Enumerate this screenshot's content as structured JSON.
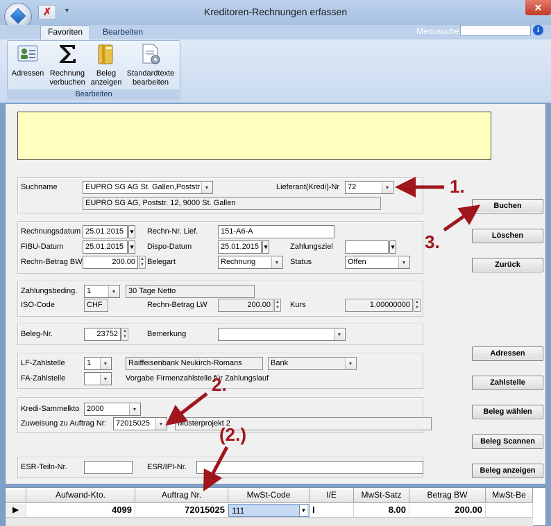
{
  "window": {
    "title": "Kreditoren-Rechnungen erfassen",
    "close_glyph": "✕",
    "qat_close_glyph": "✗",
    "qat_more_glyph": "▼",
    "info_glyph": "i"
  },
  "ribbon": {
    "tabs": [
      {
        "label": "Favoriten",
        "active": true
      },
      {
        "label": "Bearbeiten",
        "active": false
      }
    ],
    "menusuche_label": "Menusuche",
    "menusuche_value": "",
    "group_label": "Bearbeiten",
    "buttons": [
      {
        "label_line1": "Adressen",
        "label_line2": "",
        "icon": "address-book-icon"
      },
      {
        "label_line1": "Rechnung",
        "label_line2": "verbuchen",
        "icon": "sigma-icon"
      },
      {
        "label_line1": "Beleg",
        "label_line2": "anzeigen",
        "icon": "binder-icon"
      },
      {
        "label_line1": "Standardtexte",
        "label_line2": "bearbeiten",
        "icon": "document-gear-icon"
      }
    ]
  },
  "form": {
    "suchname_label": "Suchname",
    "suchname_value": "EUPRO SG AG St. Gallen,Poststr",
    "lieferant_label": "Lieferant(Kredi)-Nr",
    "lieferant_value": "72",
    "address_value": "EUPRO SG AG, Poststr. 12, 9000 St. Gallen",
    "rechnungsdatum_label": "Rechnungsdatum",
    "rechnungsdatum_value": "25.01.2015",
    "rechn_nr_lief_label": "Rechn-Nr. Lief.",
    "rechn_nr_lief_value": "151-A6-A",
    "fibu_datum_label": "FIBU-Datum",
    "fibu_datum_value": "25.01.2015",
    "dispo_datum_label": "Dispo-Datum",
    "dispo_datum_value": "25.01.2015",
    "zahlungsziel_label": "Zahlungsziel",
    "zahlungsziel_value": "",
    "rechn_betrag_bw_label": "Rechn-Betrag BW",
    "rechn_betrag_bw_value": "200.00",
    "belegart_label": "Belegart",
    "belegart_value": "Rechnung",
    "status_label": "Status",
    "status_value": "Offen",
    "zahlungsbeding_label": "Zahlungsbeding.",
    "zahlungsbeding_value": "1",
    "zahlungsbeding_text": "30 Tage Netto",
    "iso_code_label": "ISO-Code",
    "iso_code_value": "CHF",
    "rechn_betrag_lw_label": "Rechn-Betrag LW",
    "rechn_betrag_lw_value": "200.00",
    "kurs_label": "Kurs",
    "kurs_value": "1.00000000",
    "beleg_nr_label": "Beleg-Nr.",
    "beleg_nr_value": "23752",
    "bemerkung_label": "Bemerkung",
    "bemerkung_value": "",
    "lf_zahlstelle_label": "LF-Zahlstelle",
    "lf_zahlstelle_value": "1",
    "lf_zahlstelle_text": "Raiffeisenbank Neukirch-Romans",
    "lf_zahlstelle_type": "Bank",
    "fa_zahlstelle_label": "FA-Zahlstelle",
    "fa_zahlstelle_value": "",
    "fa_zahlstelle_text": "Vorgabe Firmenzahlstelle für Zahlungslauf",
    "kredi_sammelkto_label": "Kredi-Sammelkto",
    "kredi_sammelkto_value": "2000",
    "zuweisung_label": "Zuweisung zu Auftrag Nr:",
    "zuweisung_value": "72015025",
    "zuweisung_text": "Musterprojekt 2",
    "esr_teiln_label": "ESR-Teiln-Nr.",
    "esr_teiln_value": "",
    "esr_ipi_label": "ESR/IPI-Nr.",
    "esr_ipi_value": ""
  },
  "buttons": {
    "buchen": "Buchen",
    "loeschen": "Löschen",
    "zurueck": "Zurück",
    "adressen": "Adressen",
    "zahlstelle": "Zahlstelle",
    "beleg_waehlen": "Beleg wählen",
    "beleg_scannen": "Beleg Scannen",
    "beleg_anzeigen": "Beleg anzeigen"
  },
  "grid": {
    "columns": [
      "Aufwand-Kto.",
      "Auftrag Nr.",
      "MwSt-Code",
      "I/E",
      "MwSt-Satz",
      "Betrag BW",
      "MwSt-Be"
    ],
    "rows": [
      {
        "aufwand_kto": "4099",
        "auftrag_nr": "72015025",
        "mwst_code": "111",
        "ie": "I",
        "mwst_satz": "8.00",
        "betrag_bw": "200.00",
        "mwst_be": ""
      }
    ],
    "row_indicator": "▶"
  },
  "annotations": {
    "step1": "1.",
    "step2": "2.",
    "step2b": "(2.)",
    "step3": "3.",
    "color": "#a0161d"
  }
}
